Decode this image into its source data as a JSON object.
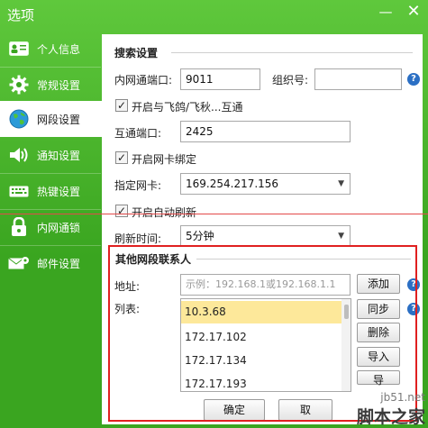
{
  "window": {
    "title": "选项",
    "min_glyph": "—",
    "close_glyph": "✕"
  },
  "sidebar": {
    "items": [
      {
        "label": "个人信息",
        "icon": "id-card-icon"
      },
      {
        "label": "常规设置",
        "icon": "gear-icon"
      },
      {
        "label": "网段设置",
        "icon": "globe-icon",
        "active": true
      },
      {
        "label": "通知设置",
        "icon": "speaker-icon"
      },
      {
        "label": "热键设置",
        "icon": "keyboard-icon"
      },
      {
        "label": "内网通锁",
        "icon": "lock-icon"
      },
      {
        "label": "邮件设置",
        "icon": "mail-gear-icon"
      }
    ]
  },
  "search": {
    "section_title": "搜索设置",
    "port_label": "内网通端口:",
    "port_value": "9011",
    "group_label": "组织号:",
    "group_value": "",
    "interop_label": "开启与飞鸽/飞秋...互通",
    "interop_checked": true,
    "interop_port_label": "互通端口:",
    "interop_port_value": "2425",
    "nic_bind_label": "开启网卡绑定",
    "nic_bind_checked": true,
    "nic_label": "指定网卡:",
    "nic_value": "169.254.217.156",
    "auto_refresh_label": "开启自动刷新",
    "auto_refresh_checked": true,
    "refresh_label": "刷新时间:",
    "refresh_value": "5分钟"
  },
  "other": {
    "section_title": "其他网段联系人",
    "address_label": "地址:",
    "address_placeholder": "示例：192.168.1或192.168.1.1",
    "add_button": "添加",
    "list_label": "列表:",
    "list_items": [
      "10.3.68",
      "172.17.102",
      "172.17.134",
      "172.17.193"
    ],
    "selected_index": 0,
    "sync_button": "同步",
    "delete_button": "删除",
    "import_button": "导入",
    "export_button": "导"
  },
  "footer": {
    "ok_button": "确定",
    "cancel_button": "取"
  },
  "watermark": {
    "site": "jb51.net",
    "name": "脚本之家"
  },
  "colors": {
    "accent_green": "#3aa520",
    "highlight": "#fde89a",
    "annotation_red": "#e02020",
    "help_blue": "#2b6fc4"
  }
}
